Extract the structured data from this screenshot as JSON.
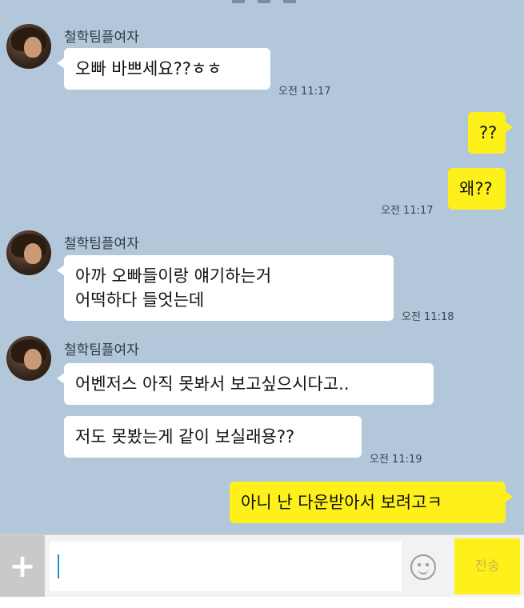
{
  "messages": [
    {
      "sender": "철학팀플여자",
      "lines": [
        "오빠 바쁘세요??ㅎㅎ"
      ],
      "time": "오전 11:17"
    },
    {
      "me": true,
      "lines": [
        "??"
      ]
    },
    {
      "me": true,
      "lines": [
        "왜??"
      ],
      "time": "오전 11:17"
    },
    {
      "sender": "철학팀플여자",
      "lines": [
        "아까 오빠들이랑 얘기하는거",
        "어떡하다 들엇는데"
      ],
      "time": "오전 11:18"
    },
    {
      "sender": "철학팀플여자",
      "lines": [
        "어벤저스 아직 못봐서 보고싶으시다고.."
      ]
    },
    {
      "lines": [
        "저도 못봤는게 같이 보실래용??"
      ],
      "time": "오전 11:19"
    },
    {
      "me": true,
      "lines": [
        "아니 난 다운받아서 보려고ㅋ"
      ]
    }
  ],
  "input": {
    "plus_label": "+",
    "send_label": "전송",
    "plus_icon": "plus-icon",
    "emoji_icon": "smiley-icon"
  },
  "colors": {
    "chat_background": "#b2c7da",
    "my_bubble": "#fef01b",
    "their_bubble": "#ffffff"
  }
}
